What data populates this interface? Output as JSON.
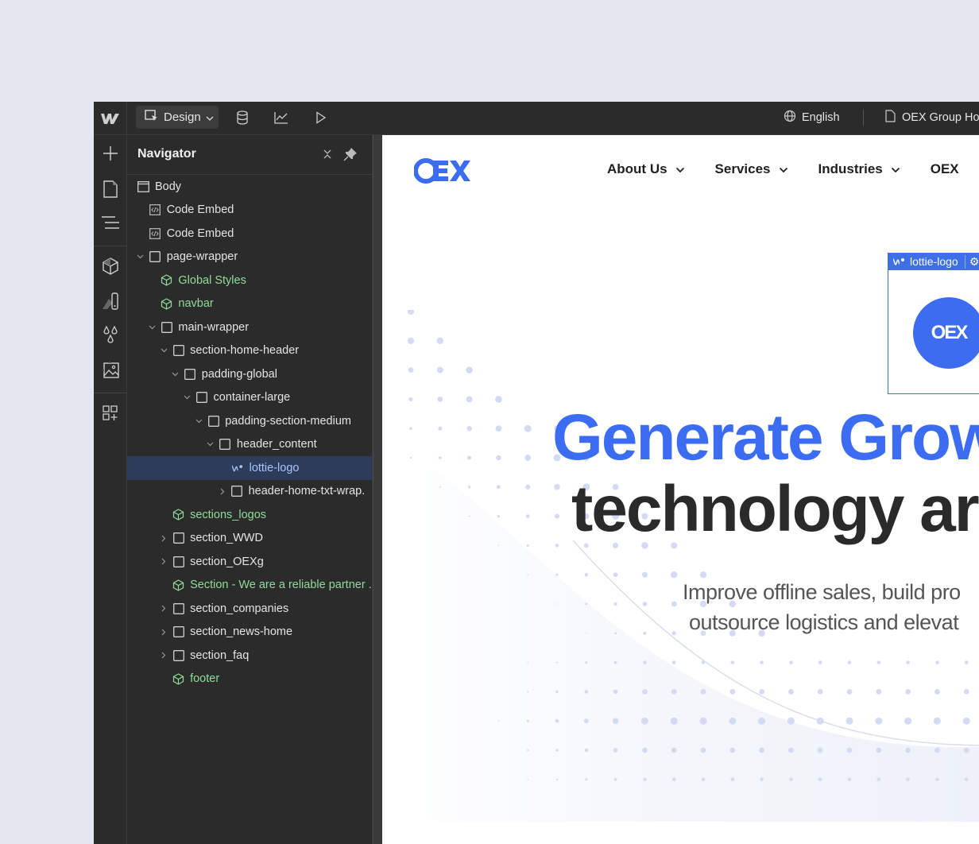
{
  "topbar": {
    "mode_label": "Design",
    "language": "English",
    "page_name": "OEX Group Ho",
    "icons": [
      "webflow-logo-icon",
      "design-cursor-icon",
      "cms-database-icon",
      "analytics-chart-icon",
      "preview-play-icon",
      "globe-icon",
      "page-icon"
    ]
  },
  "rail": {
    "items": [
      {
        "name": "add-elements",
        "icon": "plus-icon"
      },
      {
        "name": "pages",
        "icon": "page-icon"
      },
      {
        "name": "navigator",
        "icon": "navigator-lines-icon"
      },
      {
        "name": "components",
        "icon": "cube-icon"
      },
      {
        "name": "style-selectors",
        "icon": "style-swatch-icon"
      },
      {
        "name": "variables",
        "icon": "color-drops-icon"
      },
      {
        "name": "assets",
        "icon": "image-icon"
      },
      {
        "name": "apps",
        "icon": "apps-grid-icon"
      }
    ]
  },
  "navigator": {
    "title": "Navigator",
    "tree": [
      {
        "label": "Body",
        "type": "body",
        "depth": 0,
        "caret": "none"
      },
      {
        "label": "Code Embed",
        "type": "embed",
        "depth": 1,
        "caret": "none"
      },
      {
        "label": "Code Embed",
        "type": "embed",
        "depth": 1,
        "caret": "none"
      },
      {
        "label": "page-wrapper",
        "type": "box",
        "depth": 1,
        "caret": "open"
      },
      {
        "label": "Global Styles",
        "type": "component",
        "depth": 2,
        "caret": "none"
      },
      {
        "label": "navbar",
        "type": "component",
        "depth": 2,
        "caret": "none"
      },
      {
        "label": "main-wrapper",
        "type": "box",
        "depth": 2,
        "caret": "open"
      },
      {
        "label": "section-home-header",
        "type": "box",
        "depth": 3,
        "caret": "open"
      },
      {
        "label": "padding-global",
        "type": "box",
        "depth": 4,
        "caret": "open"
      },
      {
        "label": "container-large",
        "type": "box",
        "depth": 5,
        "caret": "open"
      },
      {
        "label": "padding-section-medium",
        "type": "box",
        "depth": 6,
        "caret": "open"
      },
      {
        "label": "header_content",
        "type": "box",
        "depth": 7,
        "caret": "open"
      },
      {
        "label": "lottie-logo",
        "type": "lottie",
        "depth": 8,
        "caret": "none",
        "selected": true
      },
      {
        "label": "header-home-txt-wrap.",
        "type": "box",
        "depth": 8,
        "caret": "closed"
      },
      {
        "label": "sections_logos",
        "type": "component",
        "depth": 3,
        "caret": "none"
      },
      {
        "label": "section_WWD",
        "type": "box",
        "depth": 3,
        "caret": "closed"
      },
      {
        "label": "section_OEXg",
        "type": "box",
        "depth": 3,
        "caret": "closed"
      },
      {
        "label": "Section - We are a reliable partner ...",
        "type": "component",
        "depth": 3,
        "caret": "none"
      },
      {
        "label": "section_companies",
        "type": "box",
        "depth": 3,
        "caret": "closed"
      },
      {
        "label": "section_news-home",
        "type": "box",
        "depth": 3,
        "caret": "closed"
      },
      {
        "label": "section_faq",
        "type": "box",
        "depth": 3,
        "caret": "closed"
      },
      {
        "label": "footer",
        "type": "component",
        "depth": 3,
        "caret": "none"
      }
    ]
  },
  "canvas": {
    "site_logo": "OEX",
    "nav_items": [
      {
        "label": "About Us",
        "has_dropdown": true
      },
      {
        "label": "Services",
        "has_dropdown": true
      },
      {
        "label": "Industries",
        "has_dropdown": true
      },
      {
        "label": "OEX",
        "has_dropdown": false
      }
    ],
    "selected_element_label": "lottie-logo",
    "lottie_logo_text": "OEX",
    "hero_title_line1": "Generate Grow",
    "hero_title_line2": "technology ar",
    "hero_subtitle_line1": "Improve offline sales, build pro",
    "hero_subtitle_line2": "outsource logistics and elevat"
  },
  "colors": {
    "brand_blue": "#3b6cf2",
    "selection_blue": "#3f6fe6",
    "component_green": "#8fdc98",
    "selected_row_bg": "#2c3c5a"
  }
}
